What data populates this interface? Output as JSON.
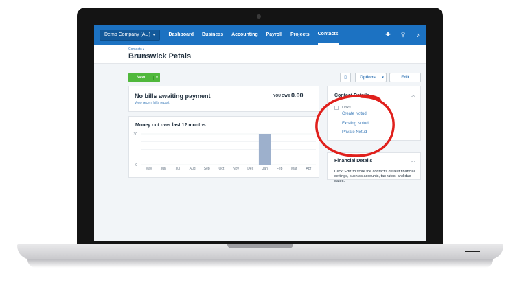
{
  "nav": {
    "org": "Demo Company (AU)",
    "items": [
      "Dashboard",
      "Business",
      "Accounting",
      "Payroll",
      "Projects",
      "Contacts"
    ],
    "active": "Contacts",
    "icons": [
      "plus-icon",
      "search-icon",
      "bell-icon"
    ]
  },
  "header": {
    "breadcrumb": "Contacts",
    "title": "Brunswick Petals"
  },
  "actions": {
    "new": "New",
    "options": "Options",
    "edit": "Edit"
  },
  "bills": {
    "heading": "No bills awaiting payment",
    "link": "View recent bills report",
    "owe_label": "YOU OWE",
    "owe_value": "0.00"
  },
  "chart_data": {
    "type": "bar",
    "title": "Money out over last 12 months",
    "categories": [
      "May",
      "Jun",
      "Jul",
      "Aug",
      "Sep",
      "Oct",
      "Nov",
      "Dec",
      "Jan",
      "Feb",
      "Mar",
      "Apr"
    ],
    "values": [
      0,
      0,
      0,
      0,
      0,
      0,
      0,
      0,
      30,
      0,
      0,
      0
    ],
    "yticks": [
      "30",
      "0"
    ],
    "ylim": [
      0,
      30
    ],
    "color": "#9db0cc"
  },
  "contact": {
    "heading": "Contact Details",
    "links_label": "Links",
    "links": [
      "Create Notud",
      "Existing Notud",
      "Private Notud"
    ]
  },
  "financial": {
    "heading": "Financial Details",
    "text": "Click 'Edit' to store the contact's default financial settings, such as accounts, tax rates, and due dates."
  },
  "colors": {
    "nav": "#1c72c2",
    "accent": "#50b83c",
    "annotation": "#e0201c"
  }
}
